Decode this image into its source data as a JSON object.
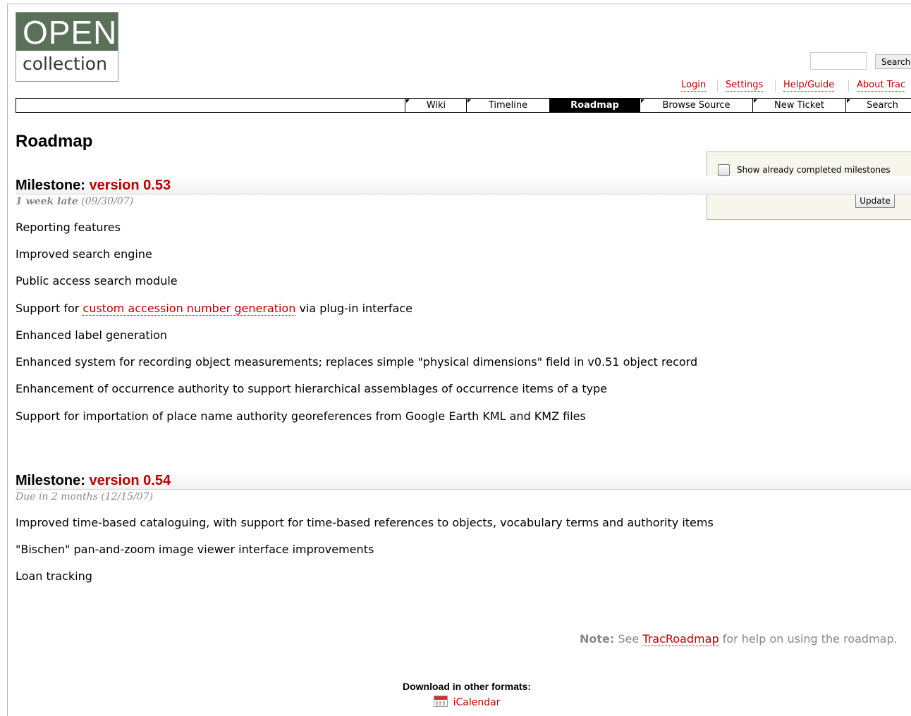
{
  "logo": {
    "line1": "OPEN",
    "line2": "collection"
  },
  "search": {
    "placeholder": "",
    "button_label": "Search"
  },
  "metanav": [
    "Login",
    "Settings",
    "Help/Guide",
    "About Trac"
  ],
  "mainnav": [
    "Wiki",
    "Timeline",
    "Roadmap",
    "Browse Source",
    "New Ticket",
    "Search"
  ],
  "mainnav_active": "Roadmap",
  "page_title": "Roadmap",
  "prefs": {
    "checkbox_label": "Show already completed milestones",
    "checked": false,
    "update_label": "Update"
  },
  "milestones": [
    {
      "prefix": "Milestone: ",
      "name": "version 0.53",
      "late": "1 week late",
      "date": "(09/30/07)",
      "items": [
        "Reporting features",
        "Improved search engine",
        "Public access search module",
        {
          "before": "Support for ",
          "link": "custom accession number generation",
          "after": " via plug-in interface"
        },
        "Enhanced label generation",
        "Enhanced system for recording object measurements; replaces simple \"physical dimensions\" field in v0.51 object record",
        "Enhancement of occurrence authority to support hierarchical assemblages of occurrence items of a type",
        "Support for importation of place name authority georeferences from Google Earth KML and KMZ files"
      ]
    },
    {
      "prefix": "Milestone: ",
      "name": "version 0.54",
      "due": "Due in 2 months (12/15/07)",
      "items": [
        "Improved time-based cataloguing, with support for time-based references to objects, vocabulary terms and authority items",
        "\"Bischen\" pan-and-zoom image viewer interface improvements",
        "Loan tracking"
      ]
    }
  ],
  "note": {
    "label": "Note:",
    "before": " See ",
    "link": "TracRoadmap",
    "after": " for help on using the roadmap."
  },
  "altlinks": {
    "heading": "Download in other formats:",
    "ical": "iCalendar",
    "ical_icon": "calendar-icon"
  },
  "colors": {
    "link": "#bb0000",
    "logo_green": "#5a7058",
    "nav_active": "#000000"
  }
}
